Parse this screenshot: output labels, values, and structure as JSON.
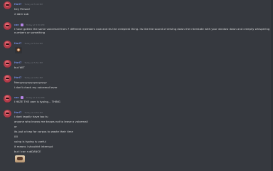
{
  "channel": {
    "groups": [
      {
        "username": "Harl7",
        "timestamp": "Today at 5:49 PM",
        "messages": [
          "hey Person!",
          "2 darn sub"
        ]
      },
      {
        "username": "can",
        "timestamp": "Today at 5:50 PM",
        "messages": [
          "I have gotten the same voicemail from 7 different members now and its the creepiest thing. its like the sound of driving down the interstate with your window down and creepily whispering numbers or something"
        ]
      },
      {
        "username": "Harl7",
        "timestamp": "Today at 5:50 PM",
        "emoji": "face-emoji"
      },
      {
        "username": "Harl7",
        "timestamp": "Today at 5:51 PM",
        "messages": [
          "but WIT"
        ]
      },
      {
        "username": "Harl7",
        "timestamp": "Today at 4:51 PM",
        "messages": [
          "Nooyyyyyyyyyyyyyyyyy",
          "i don't check my voicemail ever"
        ]
      },
      {
        "username": "can",
        "timestamp": "Today at 4:52 PM",
        "messages": [
          "I HATE THE user is typing... THING"
        ]
      },
      {
        "username": "Harl7",
        "timestamp": "Today at 4:54 PM",
        "messages": [
          "i dont legally have too tu",
          "anyone who knows me knows not to leave a voicemail",
          "or",
          "its just a trap for corpos to waste their time",
          "lOl",
          "using is typing is useful",
          "it means i shouldnt interrupt",
          "but i can rubDANCE"
        ],
        "sticker": "dancing-sticker"
      }
    ]
  },
  "colors": {
    "background": "#36393f",
    "username": "#7289da",
    "text": "#dcddde",
    "timestamp": "#72767d"
  }
}
